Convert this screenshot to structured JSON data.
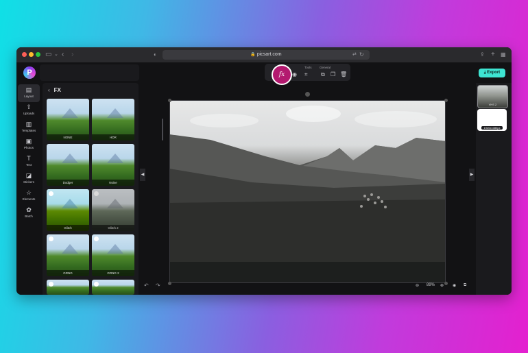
{
  "browser": {
    "url": "picsart.com",
    "icons": [
      "sidebar-icon",
      "chevron-left-icon",
      "chevron-right-icon",
      "shield-icon",
      "translate-icon",
      "reload-icon",
      "share-icon",
      "plus-icon",
      "tabs-icon"
    ]
  },
  "app": {
    "logo_letter": "P",
    "sidebar": {
      "items": [
        {
          "label": "Layout",
          "icon": "layout-icon",
          "active": true
        },
        {
          "label": "Uploads",
          "icon": "upload-icon"
        },
        {
          "label": "Templates",
          "icon": "templates-icon"
        },
        {
          "label": "Photos",
          "icon": "photos-icon"
        },
        {
          "label": "Text",
          "icon": "text-icon"
        },
        {
          "label": "Stickers",
          "icon": "stickers-icon"
        },
        {
          "label": "Elements",
          "icon": "star-icon"
        },
        {
          "label": "Batch",
          "icon": "batch-icon"
        }
      ]
    },
    "fx_panel": {
      "title": "FX",
      "effects": [
        "NONE",
        "HDR",
        "Dodger",
        "Noise",
        "Glitch",
        "Glitch 2",
        "GRNG",
        "GRNG 2"
      ]
    },
    "toolbar": {
      "fx_label": "fx",
      "tools_label": "Tools",
      "general_label": "General"
    },
    "export_label": "Export",
    "zoom": "89%",
    "right_panel": {
      "slides": [
        {
          "label": "VHS 2"
        },
        {
          "label": "1920x1080px"
        }
      ]
    }
  },
  "colors": {
    "accent": "#3ee4d2",
    "fx_active": "#b3196f",
    "bg": "#121214"
  }
}
